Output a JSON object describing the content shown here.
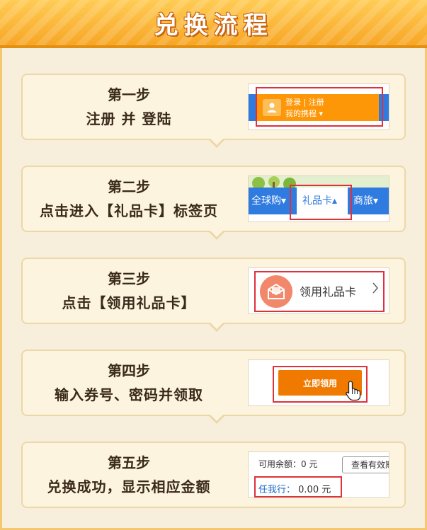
{
  "banner": {
    "title": "兑换流程"
  },
  "steps": [
    {
      "title": "第一步",
      "desc": "注册 并 登陆",
      "shot": {
        "line1": "登录 | 注册",
        "line2": "我的携程 ▾"
      }
    },
    {
      "title": "第二步",
      "desc": "点击进入【礼品卡】标签页",
      "shot": {
        "nav_global": "全球购▾",
        "nav_giftcard": "礼品卡▴",
        "nav_travel": "商旅▾"
      }
    },
    {
      "title": "第三步",
      "desc": "点击【领用礼品卡】",
      "shot": {
        "label": "领用礼品卡"
      }
    },
    {
      "title": "第四步",
      "desc": "输入券号、密码并领取",
      "shot": {
        "button": "立即领用"
      }
    },
    {
      "title": "第五步",
      "desc": "兑换成功，显示相应金额",
      "shot": {
        "balance": "可用余额：0 元",
        "check_button": "查看有效期",
        "anytime_label": "任我行：",
        "anytime_value": "0.00 元"
      }
    }
  ],
  "colors": {
    "banner": "#f7a625",
    "nav_blue": "#2f7be0",
    "orange": "#fd9708",
    "highlight": "#e0303a"
  },
  "icons": [
    "user-icon",
    "envelope-icon",
    "chevron-right-icon",
    "hand-pointer-icon"
  ]
}
